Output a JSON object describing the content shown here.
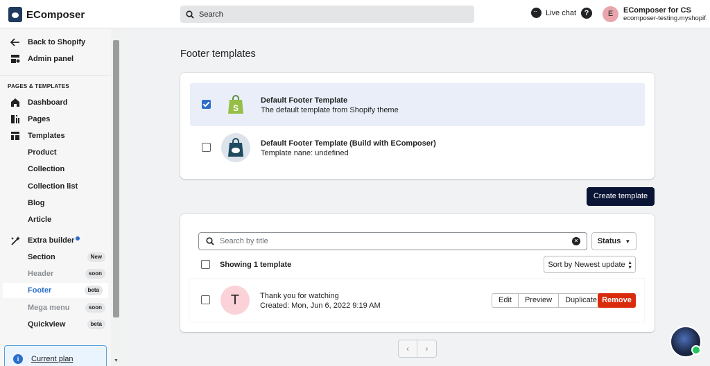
{
  "app": {
    "name": "EComposer"
  },
  "search": {
    "placeholder": "Search"
  },
  "topbar": {
    "live_chat": "Live chat",
    "help": "?",
    "avatar_initial": "E",
    "store_name": "EComposer for CS",
    "store_url": "ecomposer-testing.myshopif..."
  },
  "sidebar": {
    "back": "Back to Shopify",
    "admin": "Admin panel",
    "section_title": "PAGES & TEMPLATES",
    "dashboard": "Dashboard",
    "pages": "Pages",
    "templates": "Templates",
    "sub": {
      "product": "Product",
      "collection": "Collection",
      "collection_list": "Collection list",
      "blog": "Blog",
      "article": "Article"
    },
    "extra_builder": "Extra builder",
    "extra": {
      "section": "Section",
      "section_tag": "New",
      "header": "Header",
      "header_tag": "soon",
      "footer": "Footer",
      "footer_tag": "beta",
      "mega_menu": "Mega menu",
      "mega_menu_tag": "soon",
      "quickview": "Quickview",
      "quickview_tag": "beta"
    },
    "current_plan": "Current plan"
  },
  "main": {
    "title": "Footer templates",
    "defaults": [
      {
        "title": "Default Footer Template",
        "subtitle": "The default template from Shopify theme",
        "checked": true
      },
      {
        "title": "Default Footer Template (Build with EComposer)",
        "subtitle": "Template nane: undefined",
        "checked": false
      }
    ],
    "create_button": "Create template",
    "filter": {
      "placeholder": "Search by title",
      "status": "Status"
    },
    "showing": "Showing 1 template",
    "sort": "Sort by Newest update",
    "templates": [
      {
        "initial": "T",
        "title": "Thank you for watching",
        "created": "Created: Mon, Jun 6, 2022 9:19 AM"
      }
    ],
    "actions": {
      "edit": "Edit",
      "preview": "Preview",
      "duplicate": "Duplicate",
      "remove": "Remove"
    },
    "pager": {
      "prev": "‹",
      "next": "›"
    }
  },
  "colors": {
    "primary": "#0a1535",
    "danger": "#d82c0d",
    "selected_row": "#e9eef8",
    "link": "#2c6ecb"
  }
}
